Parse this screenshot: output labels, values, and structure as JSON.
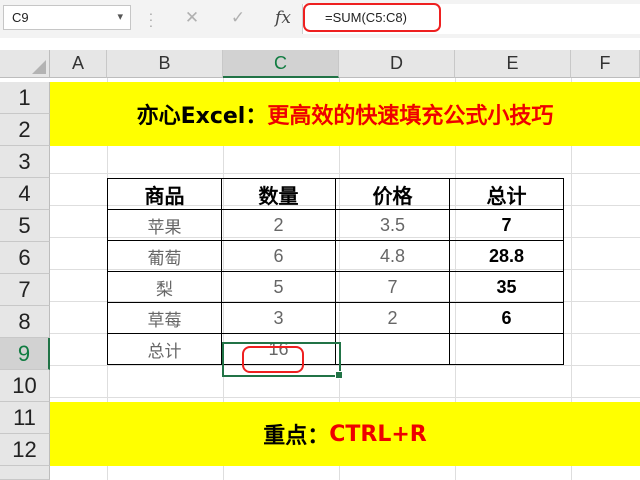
{
  "formula_bar": {
    "name_box": "C9",
    "dropdown_icon": "chevron-down-icon",
    "cancel_icon": "close-icon",
    "enter_icon": "check-icon",
    "fx_label": "fx",
    "formula": "=SUM(C5:C8)",
    "highlight_color": "#ee2020"
  },
  "columns": [
    "A",
    "B",
    "C",
    "D",
    "E",
    "F"
  ],
  "rows": [
    "1",
    "2",
    "3",
    "4",
    "5",
    "6",
    "7",
    "8",
    "9",
    "10",
    "11",
    "12"
  ],
  "selected": {
    "column": "C",
    "row": "9"
  },
  "banner_top": {
    "part1": "亦心Excel：",
    "part2": "更高效的快速填充公式小技巧",
    "background": "#ffff00"
  },
  "table": {
    "headers": [
      "商品",
      "数量",
      "价格",
      "总计"
    ],
    "rows": [
      {
        "item": "苹果",
        "qty": "2",
        "price": "3.5",
        "total": "7"
      },
      {
        "item": "葡萄",
        "qty": "6",
        "price": "4.8",
        "total": "28.8"
      },
      {
        "item": "梨",
        "qty": "5",
        "price": "7",
        "total": "35"
      },
      {
        "item": "草莓",
        "qty": "3",
        "price": "2",
        "total": "6"
      }
    ],
    "sum_row": {
      "label": "总计",
      "qty": "16",
      "price": "",
      "total": ""
    }
  },
  "banner_bottom": {
    "part1": "重点：",
    "part2": "CTRL+R"
  },
  "accent_green": "#217346"
}
